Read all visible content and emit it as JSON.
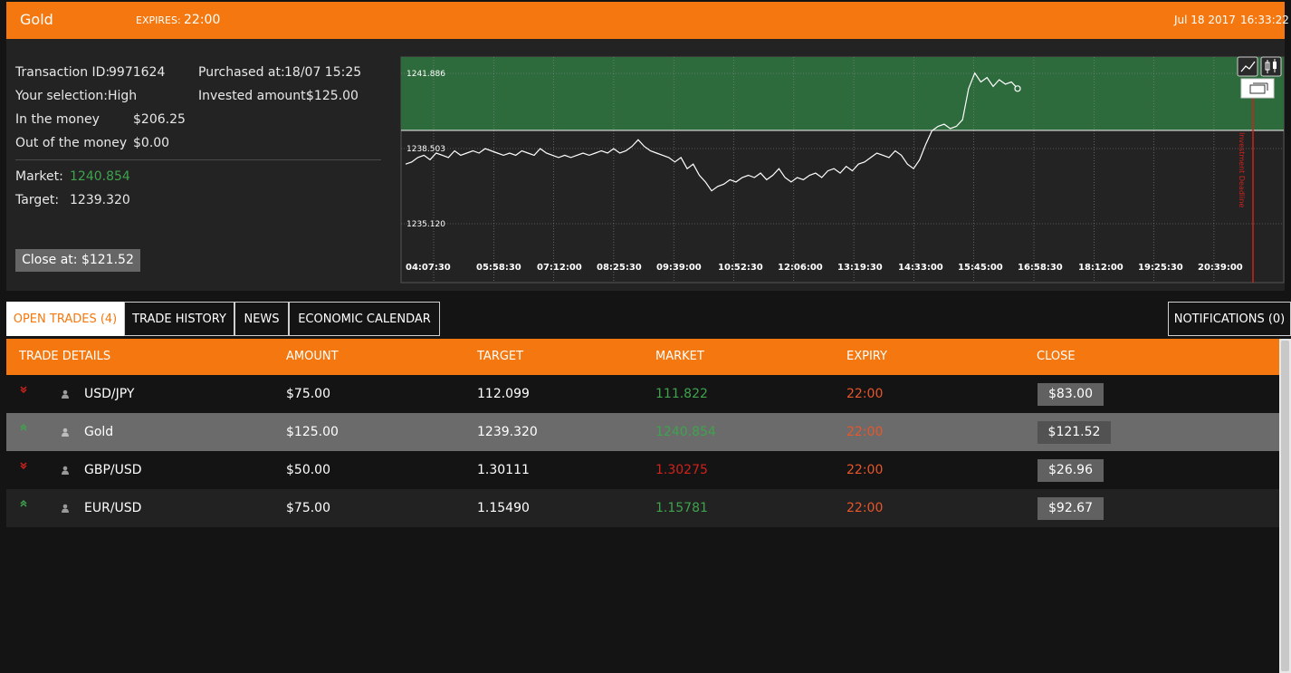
{
  "header": {
    "asset": "Gold",
    "expires_label": "EXPIRES:",
    "expires_value": "22:00",
    "date": "Jul 18 2017",
    "time": "16:33:22"
  },
  "details": {
    "transaction_id_label": "Transaction ID:",
    "transaction_id": "9971624",
    "selection_label": "Your selection:",
    "selection": "High",
    "in_money_label": "In the money",
    "in_money": "$206.25",
    "out_money_label": "Out of the money",
    "out_money": "$0.00",
    "purchased_label": "Purchased at:",
    "purchased": "18/07 15:25",
    "invested_label": "Invested amount:",
    "invested": "$125.00",
    "market_label": "Market:",
    "market": "1240.854",
    "target_label": "Target:",
    "target": "1239.320",
    "close_button": "Close at: $121.52"
  },
  "chart_data": {
    "type": "line",
    "y_tick_labels": [
      "1241.886",
      "1238.503",
      "1235.120"
    ],
    "x_tick_labels": [
      "04:07:30",
      "05:58:30",
      "07:12:00",
      "08:25:30",
      "09:39:00",
      "10:52:30",
      "12:06:00",
      "13:19:30",
      "14:33:00",
      "15:45:00",
      "16:58:30",
      "18:12:00",
      "19:25:30",
      "20:39:00"
    ],
    "ylim": [
      1235.12,
      1241.886
    ],
    "target": 1239.32,
    "deadline_label": "Investment Deadline",
    "grid": true,
    "colors": {
      "in_money_zone": "#2e6b3c",
      "out_zone": "#232323",
      "line": "#ffffff",
      "deadline": "#d0221c"
    },
    "series": [
      {
        "values": [
          1237.8,
          1237.9,
          1238.1,
          1238.2,
          1238.0,
          1238.3,
          1238.2,
          1238.1,
          1238.4,
          1238.2,
          1238.3,
          1238.4,
          1238.3,
          1238.5,
          1238.4,
          1238.3,
          1238.2,
          1238.3,
          1238.2,
          1238.4,
          1238.3,
          1238.2,
          1238.5,
          1238.3,
          1238.2,
          1238.1,
          1238.2,
          1238.1,
          1238.2,
          1238.3,
          1238.2,
          1238.3,
          1238.4,
          1238.3,
          1238.5,
          1238.3,
          1238.4,
          1238.6,
          1238.9,
          1238.6,
          1238.4,
          1238.3,
          1238.2,
          1238.1,
          1237.9,
          1238.1,
          1237.6,
          1237.8,
          1237.3,
          1237.0,
          1236.6,
          1236.8,
          1236.9,
          1237.1,
          1237.0,
          1237.2,
          1237.3,
          1237.2,
          1237.4,
          1237.1,
          1237.3,
          1237.6,
          1237.2,
          1237.0,
          1237.2,
          1237.1,
          1237.3,
          1237.4,
          1237.2,
          1237.5,
          1237.6,
          1237.4,
          1237.7,
          1237.5,
          1237.8,
          1237.9,
          1238.1,
          1238.3,
          1238.2,
          1238.1,
          1238.4,
          1238.2,
          1237.8,
          1237.6,
          1238.0,
          1238.7,
          1239.3,
          1239.5,
          1239.6,
          1239.4,
          1239.5,
          1239.8,
          1241.2,
          1241.9,
          1241.5,
          1241.7,
          1241.3,
          1241.6,
          1241.4,
          1241.5,
          1241.2
        ]
      }
    ]
  },
  "chart_controls": {
    "line_icon": "line-chart-icon",
    "candle_icon": "candlestick-icon",
    "window_icon": "window-icon"
  },
  "tabs": [
    {
      "label": "OPEN TRADES (4)"
    },
    {
      "label": "TRADE HISTORY"
    },
    {
      "label": "NEWS"
    },
    {
      "label": "ECONOMIC CALENDAR"
    }
  ],
  "notifications": "NOTIFICATIONS (0)",
  "table": {
    "headers": [
      "TRADE DETAILS",
      "AMOUNT",
      "TARGET",
      "MARKET",
      "EXPIRY",
      "CLOSE"
    ],
    "rows": [
      {
        "direction": "down",
        "asset": "USD/JPY",
        "amount": "$75.00",
        "target": "112.099",
        "market": "111.822",
        "market_color": "#3fa34d",
        "expiry": "22:00",
        "close": "$83.00"
      },
      {
        "direction": "up",
        "asset": "Gold",
        "amount": "$125.00",
        "target": "1239.320",
        "market": "1240.854",
        "market_color": "#3fa34d",
        "expiry": "22:00",
        "close": "$121.52"
      },
      {
        "direction": "down",
        "asset": "GBP/USD",
        "amount": "$50.00",
        "target": "1.30111",
        "market": "1.30275",
        "market_color": "#d0221c",
        "expiry": "22:00",
        "close": "$26.96"
      },
      {
        "direction": "up",
        "asset": "EUR/USD",
        "amount": "$75.00",
        "target": "1.15490",
        "market": "1.15781",
        "market_color": "#3fa34d",
        "expiry": "22:00",
        "close": "$92.67"
      }
    ]
  },
  "colors": {
    "accent": "#f4780f",
    "up": "#3fa34d",
    "down": "#d0221c",
    "expiry": "#e8562a"
  }
}
